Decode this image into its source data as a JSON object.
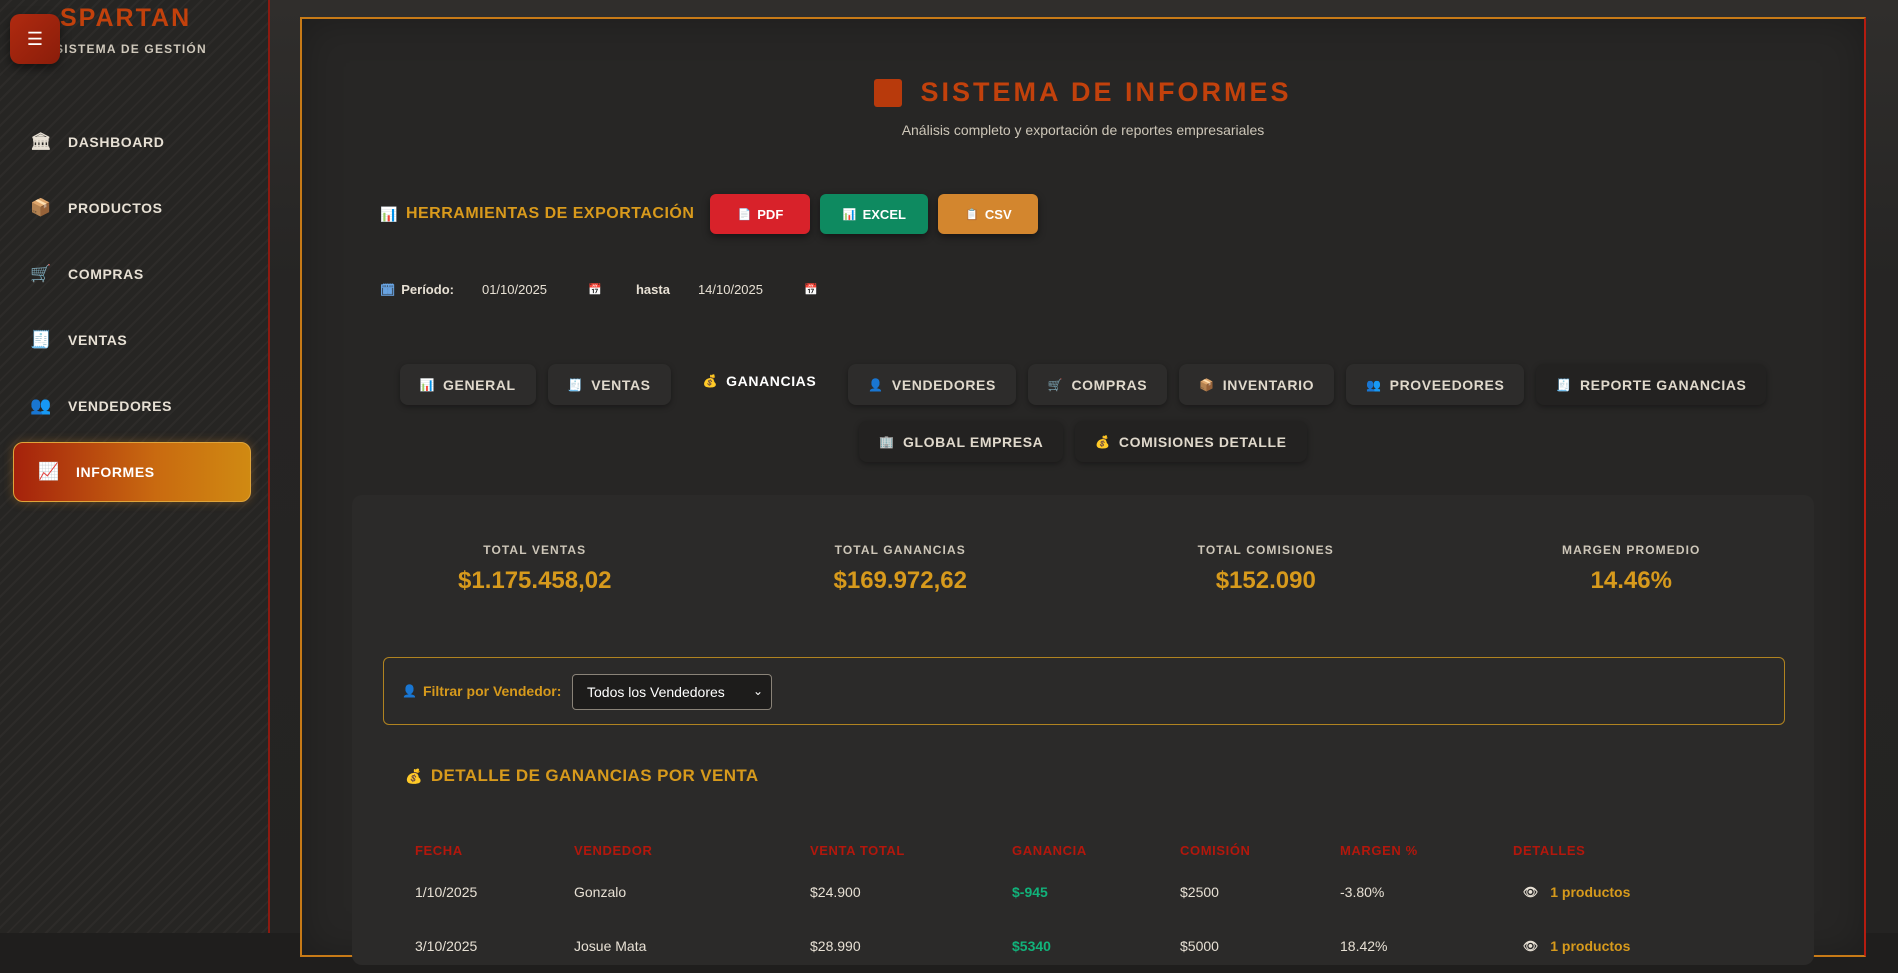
{
  "brand": {
    "name": "SPARTAN",
    "subtitle": "SISTEMA DE GESTIÓN",
    "menu_icon": "☰"
  },
  "nav": [
    {
      "label": "DASHBOARD",
      "icon": "🏛"
    },
    {
      "label": "PRODUCTOS",
      "icon": "📦"
    },
    {
      "label": "COMPRAS",
      "icon": "🛒"
    },
    {
      "label": "VENTAS",
      "icon": "🧾"
    },
    {
      "label": "VENDEDORES",
      "icon": "👥"
    },
    {
      "label": "INFORMES",
      "icon": "📈",
      "active": true
    }
  ],
  "header": {
    "title": "SISTEMA DE INFORMES",
    "subtitle": "Análisis completo y exportación de reportes empresariales"
  },
  "export": {
    "label": "HERRAMIENTAS DE EXPORTACIÓN",
    "icon": "📊",
    "pdf": "PDF",
    "pdf_icon": "📄",
    "excel": "EXCEL",
    "excel_icon": "📊",
    "csv": "CSV",
    "csv_icon": "📋"
  },
  "period": {
    "label": "Período:",
    "icon": "🗓",
    "from": "01/10/2025",
    "to_label": "hasta",
    "to": "14/10/2025",
    "cal_icon": "📅"
  },
  "tabs": {
    "row1": [
      {
        "label": "GENERAL",
        "icon": "📊"
      },
      {
        "label": "VENTAS",
        "icon": "🧾"
      },
      {
        "label": "GANANCIAS",
        "icon": "💰",
        "active": true
      },
      {
        "label": "VENDEDORES",
        "icon": "👤"
      },
      {
        "label": "COMPRAS",
        "icon": "🛒"
      },
      {
        "label": "INVENTARIO",
        "icon": "📦"
      },
      {
        "label": "PROVEEDORES",
        "icon": "👥"
      },
      {
        "label": "REPORTE GANANCIAS",
        "icon": "🧾"
      }
    ],
    "row2": [
      {
        "label": "GLOBAL EMPRESA",
        "icon": "🏢"
      },
      {
        "label": "COMISIONES DETALLE",
        "icon": "💰"
      }
    ]
  },
  "stats": [
    {
      "label": "TOTAL VENTAS",
      "value": "$1.175.458,02"
    },
    {
      "label": "TOTAL GANANCIAS",
      "value": "$169.972,62"
    },
    {
      "label": "TOTAL COMISIONES",
      "value": "$152.090"
    },
    {
      "label": "MARGEN PROMEDIO",
      "value": "14.46%"
    }
  ],
  "filter": {
    "label": "Filtrar por Vendedor:",
    "icon": "👤",
    "selected": "Todos los Vendedores"
  },
  "detail": {
    "title": "DETALLE DE GANANCIAS POR VENTA",
    "icon": "💰",
    "columns": [
      "FECHA",
      "VENDEDOR",
      "VENTA TOTAL",
      "GANANCIA",
      "COMISIÓN",
      "MARGEN %",
      "DETALLES"
    ],
    "rows": [
      {
        "fecha": "1/10/2025",
        "vendedor": "Gonzalo",
        "venta": "$24.900",
        "ganancia": "$-945",
        "comision": "$2500",
        "margen": "-3.80%",
        "detalles": "1 productos"
      },
      {
        "fecha": "3/10/2025",
        "vendedor": "Josue Mata",
        "venta": "$28.990",
        "ganancia": "$5340",
        "comision": "$5000",
        "margen": "18.42%",
        "detalles": "1 productos"
      }
    ],
    "eye_icon": "👁"
  },
  "colors": {
    "accent": "#d79a1c",
    "brand": "#c2410c",
    "danger": "#d8222a",
    "success": "#0e8a60",
    "gain": "#11b27a"
  }
}
